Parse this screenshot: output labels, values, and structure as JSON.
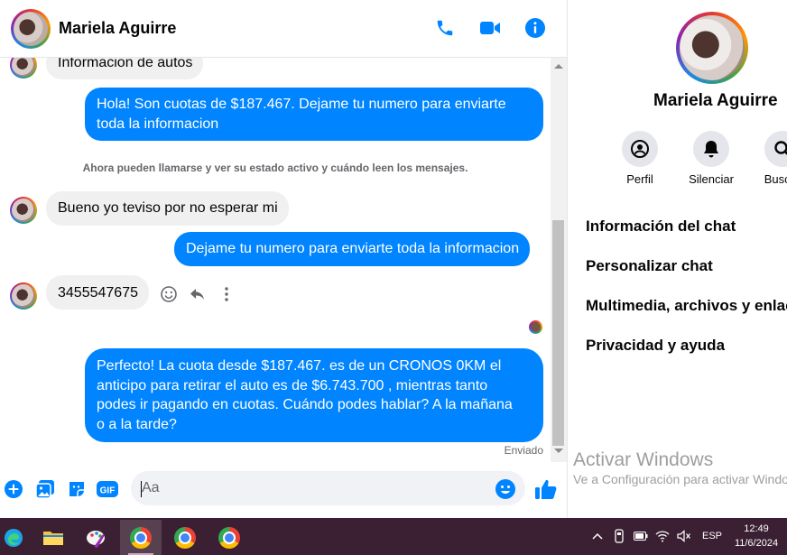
{
  "header": {
    "contact_name": "Mariela Aguirre",
    "actions": [
      "phone-icon",
      "video-call-icon",
      "info-icon"
    ],
    "accent": "#0084ff"
  },
  "messages": [
    {
      "side": "in",
      "text": "Informacion de autos"
    },
    {
      "side": "out",
      "lines": [
        "Hola! Son cuotas de $187.467. Dejame tu numero para enviarte",
        "toda la informacion"
      ]
    },
    {
      "side": "notice",
      "text": "Ahora pueden llamarse y ver su estado activo y cuándo leen los mensajes."
    },
    {
      "side": "in",
      "text": "Bueno yo teviso por no esperar mi"
    },
    {
      "side": "out",
      "text": "Dejame tu numero para enviarte toda la informacion"
    },
    {
      "side": "in",
      "text": "3455547675",
      "tools": [
        "react-emoji-icon",
        "reply-icon",
        "more-options-icon"
      ]
    },
    {
      "side": "out",
      "lines": [
        "Perfecto! La cuota desde $187.467. es de un CRONOS 0KM el",
        "anticipo para retirar el auto es de $6.743.700 , mientras tanto",
        "podes ir pagando en cuotas. Cuándo podes hablar? A la mañana",
        "o a la tarde?"
      ]
    }
  ],
  "status_text": "Enviado",
  "composer": {
    "placeholder": "Aa",
    "icons": [
      "plus-icon",
      "photo-icon",
      "sticker-icon",
      "gif-icon",
      "emoji-icon",
      "thumbs-up-icon"
    ]
  },
  "panel": {
    "name": "Mariela Aguirre",
    "buttons": [
      {
        "label": "Perfil",
        "icon": "profile-icon"
      },
      {
        "label": "Silenciar",
        "icon": "bell-icon"
      },
      {
        "label": "Buscar",
        "icon": "search-icon"
      }
    ],
    "menu": [
      "Información del chat",
      "Personalizar chat",
      "Multimedia, archivos y enlaces",
      "Privacidad y ayuda"
    ],
    "watermark_title": "Activar Windows",
    "watermark_sub": "Ve a Configuración para activar Windows."
  },
  "taskbar": {
    "apps": [
      "edge-icon",
      "file-explorer-icon",
      "paint-icon",
      "chrome-icon",
      "chrome-profile-icon",
      "chrome-profile-2-icon"
    ],
    "language": "ESP",
    "time": "12:49",
    "date": "11/6/2024",
    "bg_color": "#3a2032"
  }
}
